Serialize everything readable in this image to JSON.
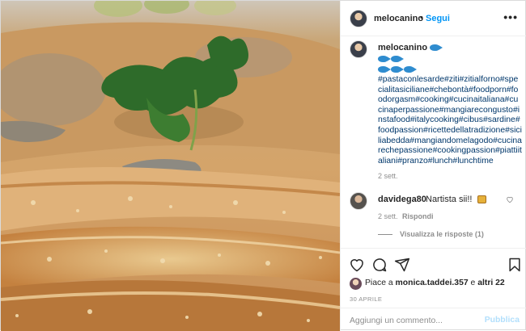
{
  "post": {
    "username": "melocanino",
    "separator": "•",
    "follow_label": "Segui",
    "more_label": "•••"
  },
  "caption": {
    "username": "melocanino",
    "emoji_rows": [
      2,
      3
    ],
    "hashtags": "#pastaconlesarde#ziti#zitialforno#specialitasiciliane#chebontà#foodporn#foodorgasm#cooking#cucinaitaliana#cucinaperpassione#mangiarecongusto#instafood#italycooking#cibus#sardine#foodpassion#ricettedellatradizione#siciliabedda#mangiandomelagodo#cucinarechepassione#cookingpassion#piattiitaliani#pranzo#lunch#lunchtime",
    "time": "2 sett."
  },
  "comment": {
    "username": "davidega80",
    "text": "Nartista sii!!",
    "time": "2 sett.",
    "reply_label": "Rispondi",
    "view_replies_label": "Visualizza le risposte (1)"
  },
  "likes": {
    "prefix": "Piace a ",
    "user": "monica.taddei.357",
    "middle": " e ",
    "others": "altri 22"
  },
  "date": "30 APRILE",
  "comment_box": {
    "placeholder": "Aggiungi un commento...",
    "publish_label": "Pubblica"
  },
  "colors": {
    "accent": "#0095f6",
    "link": "#00376b",
    "muted": "#8e8e8e",
    "publish_disabled": "#b2dffc"
  },
  "icons": [
    "like-icon",
    "comment-icon",
    "share-icon",
    "save-icon",
    "heart-icon",
    "more-icon"
  ]
}
